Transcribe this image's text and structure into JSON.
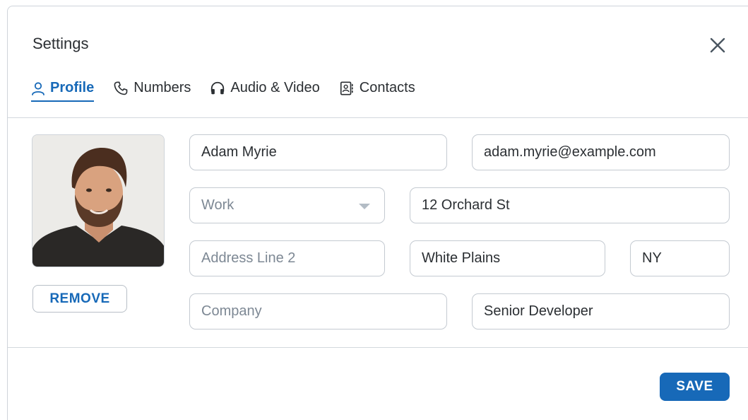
{
  "dialog": {
    "title": "Settings"
  },
  "tabs": [
    {
      "label": "Profile",
      "icon": "person-icon",
      "active": true
    },
    {
      "label": "Numbers",
      "icon": "phone-icon",
      "active": false
    },
    {
      "label": "Audio & Video",
      "icon": "headphones-icon",
      "active": false
    },
    {
      "label": "Contacts",
      "icon": "contact-book-icon",
      "active": false
    }
  ],
  "profile": {
    "remove_label": "REMOVE",
    "name": "Adam Myrie",
    "email": "adam.myrie@example.com",
    "address_type": "Work",
    "address_line1": "12 Orchard St",
    "address_line2_placeholder": "Address Line 2",
    "city": "White Plains",
    "state": "NY",
    "company_placeholder": "Company",
    "job_title": "Senior Developer"
  },
  "footer": {
    "save_label": "SAVE"
  },
  "colors": {
    "accent": "#1769b8",
    "border": "#c4cad1",
    "placeholder": "#7d8894"
  }
}
